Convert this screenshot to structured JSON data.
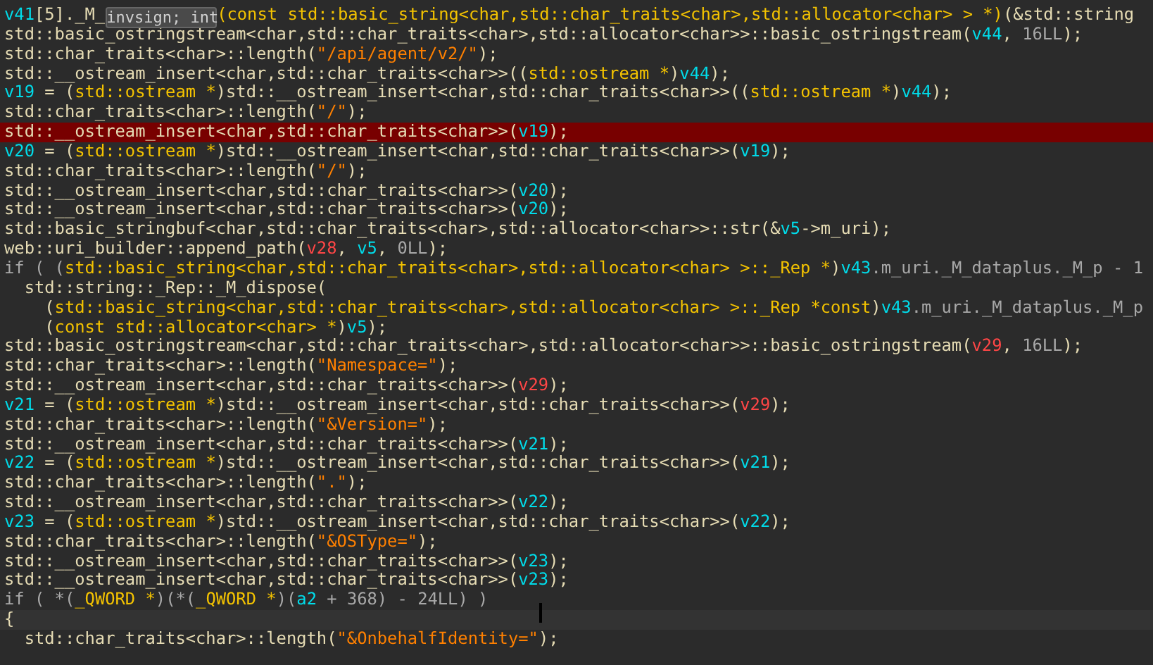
{
  "lines": [
    {
      "kind": "normal",
      "segments": [
        {
          "kind": "var",
          "text": "v41"
        },
        {
          "kind": "plain",
          "text": "[5]._M_"
        },
        {
          "kind": "tooltip",
          "text": "invsign; int"
        },
        {
          "kind": "type",
          "text": "(const std::basic_string<char,std::char_traits<char>,std::allocator<char> > *)"
        },
        {
          "kind": "plain",
          "text": "(&std::string"
        }
      ]
    },
    {
      "kind": "normal",
      "segments": [
        {
          "kind": "plain",
          "text": "std::basic_ostringstream<char,std::char_traits<char>,std::allocator<char>>::basic_ostringstream("
        },
        {
          "kind": "var",
          "text": "v44"
        },
        {
          "kind": "plain",
          "text": ", "
        },
        {
          "kind": "number",
          "text": "16LL"
        },
        {
          "kind": "plain",
          "text": ");"
        }
      ]
    },
    {
      "kind": "normal",
      "segments": [
        {
          "kind": "plain",
          "text": "std::char_traits<char>::length("
        },
        {
          "kind": "string",
          "text": "\"/api/agent/v2/\""
        },
        {
          "kind": "plain",
          "text": ");"
        }
      ]
    },
    {
      "kind": "normal",
      "segments": [
        {
          "kind": "plain",
          "text": "std::__ostream_insert<char,std::char_traits<char>>(("
        },
        {
          "kind": "type",
          "text": "std::ostream *"
        },
        {
          "kind": "plain",
          "text": ")"
        },
        {
          "kind": "var",
          "text": "v44"
        },
        {
          "kind": "plain",
          "text": ");"
        }
      ]
    },
    {
      "kind": "normal",
      "segments": [
        {
          "kind": "var",
          "text": "v19"
        },
        {
          "kind": "plain",
          "text": " = ("
        },
        {
          "kind": "type",
          "text": "std::ostream *"
        },
        {
          "kind": "plain",
          "text": ")std::__ostream_insert<char,std::char_traits<char>>(("
        },
        {
          "kind": "type",
          "text": "std::ostream *"
        },
        {
          "kind": "plain",
          "text": ")"
        },
        {
          "kind": "var",
          "text": "v44"
        },
        {
          "kind": "plain",
          "text": ");"
        }
      ]
    },
    {
      "kind": "normal",
      "segments": [
        {
          "kind": "plain",
          "text": "std::char_traits<char>::length("
        },
        {
          "kind": "string",
          "text": "\"/\""
        },
        {
          "kind": "plain",
          "text": ");"
        }
      ]
    },
    {
      "kind": "breakpoint",
      "segments": [
        {
          "kind": "plain",
          "text": "std::__ostream_insert<char,std::char_traits<char>>("
        },
        {
          "kind": "var",
          "text": "v19"
        },
        {
          "kind": "plain",
          "text": ");"
        }
      ]
    },
    {
      "kind": "normal",
      "segments": [
        {
          "kind": "var",
          "text": "v20"
        },
        {
          "kind": "plain",
          "text": " = ("
        },
        {
          "kind": "type",
          "text": "std::ostream *"
        },
        {
          "kind": "plain",
          "text": ")std::__ostream_insert<char,std::char_traits<char>>("
        },
        {
          "kind": "var",
          "text": "v19"
        },
        {
          "kind": "plain",
          "text": ");"
        }
      ]
    },
    {
      "kind": "normal",
      "segments": [
        {
          "kind": "plain",
          "text": "std::char_traits<char>::length("
        },
        {
          "kind": "string",
          "text": "\"/\""
        },
        {
          "kind": "plain",
          "text": ");"
        }
      ]
    },
    {
      "kind": "normal",
      "segments": [
        {
          "kind": "plain",
          "text": "std::__ostream_insert<char,std::char_traits<char>>("
        },
        {
          "kind": "var",
          "text": "v20"
        },
        {
          "kind": "plain",
          "text": ");"
        }
      ]
    },
    {
      "kind": "normal",
      "segments": [
        {
          "kind": "plain",
          "text": "std::__ostream_insert<char,std::char_traits<char>>("
        },
        {
          "kind": "var",
          "text": "v20"
        },
        {
          "kind": "plain",
          "text": ");"
        }
      ]
    },
    {
      "kind": "normal",
      "segments": [
        {
          "kind": "plain",
          "text": "std::basic_stringbuf<char,std::char_traits<char>,std::allocator<char>>::str(&"
        },
        {
          "kind": "var",
          "text": "v5"
        },
        {
          "kind": "plain",
          "text": "->m_uri);"
        }
      ]
    },
    {
      "kind": "normal",
      "segments": [
        {
          "kind": "plain",
          "text": "web::uri_builder::append_path("
        },
        {
          "kind": "local",
          "text": "v28"
        },
        {
          "kind": "plain",
          "text": ", "
        },
        {
          "kind": "var",
          "text": "v5"
        },
        {
          "kind": "plain",
          "text": ", "
        },
        {
          "kind": "number",
          "text": "0LL"
        },
        {
          "kind": "plain",
          "text": ");"
        }
      ]
    },
    {
      "kind": "normal",
      "segments": [
        {
          "kind": "keyword",
          "text": "if ( ("
        },
        {
          "kind": "type",
          "text": "std::basic_string<char,std::char_traits<char>,std::allocator<char> >::_Rep *"
        },
        {
          "kind": "plain",
          "text": ")"
        },
        {
          "kind": "var",
          "text": "v43"
        },
        {
          "kind": "number",
          "text": ".m_uri._M_dataplus._M_p - 1"
        }
      ]
    },
    {
      "kind": "normal",
      "segments": [
        {
          "kind": "plain",
          "text": "  std::string::_Rep::_M_dispose("
        }
      ]
    },
    {
      "kind": "normal",
      "segments": [
        {
          "kind": "plain",
          "text": "    ("
        },
        {
          "kind": "type",
          "text": "std::basic_string<char,std::char_traits<char>,std::allocator<char> >::_Rep *const"
        },
        {
          "kind": "plain",
          "text": ")"
        },
        {
          "kind": "var",
          "text": "v43"
        },
        {
          "kind": "number",
          "text": ".m_uri._M_dataplus._M_p"
        }
      ]
    },
    {
      "kind": "normal",
      "segments": [
        {
          "kind": "plain",
          "text": "    ("
        },
        {
          "kind": "type",
          "text": "const std::allocator<char> *"
        },
        {
          "kind": "plain",
          "text": ")"
        },
        {
          "kind": "var",
          "text": "v5"
        },
        {
          "kind": "plain",
          "text": ");"
        }
      ]
    },
    {
      "kind": "normal",
      "segments": [
        {
          "kind": "plain",
          "text": "std::basic_ostringstream<char,std::char_traits<char>,std::allocator<char>>::basic_ostringstream("
        },
        {
          "kind": "local",
          "text": "v29"
        },
        {
          "kind": "plain",
          "text": ", "
        },
        {
          "kind": "number",
          "text": "16LL"
        },
        {
          "kind": "plain",
          "text": ");"
        }
      ]
    },
    {
      "kind": "normal",
      "segments": [
        {
          "kind": "plain",
          "text": "std::char_traits<char>::length("
        },
        {
          "kind": "string",
          "text": "\"Namespace=\""
        },
        {
          "kind": "plain",
          "text": ");"
        }
      ]
    },
    {
      "kind": "normal",
      "segments": [
        {
          "kind": "plain",
          "text": "std::__ostream_insert<char,std::char_traits<char>>("
        },
        {
          "kind": "local",
          "text": "v29"
        },
        {
          "kind": "plain",
          "text": ");"
        }
      ]
    },
    {
      "kind": "normal",
      "segments": [
        {
          "kind": "var",
          "text": "v21"
        },
        {
          "kind": "plain",
          "text": " = ("
        },
        {
          "kind": "type",
          "text": "std::ostream *"
        },
        {
          "kind": "plain",
          "text": ")std::__ostream_insert<char,std::char_traits<char>>("
        },
        {
          "kind": "local",
          "text": "v29"
        },
        {
          "kind": "plain",
          "text": ");"
        }
      ]
    },
    {
      "kind": "normal",
      "segments": [
        {
          "kind": "plain",
          "text": "std::char_traits<char>::length("
        },
        {
          "kind": "string",
          "text": "\"&Version=\""
        },
        {
          "kind": "plain",
          "text": ");"
        }
      ]
    },
    {
      "kind": "normal",
      "segments": [
        {
          "kind": "plain",
          "text": "std::__ostream_insert<char,std::char_traits<char>>("
        },
        {
          "kind": "var",
          "text": "v21"
        },
        {
          "kind": "plain",
          "text": ");"
        }
      ]
    },
    {
      "kind": "normal",
      "segments": [
        {
          "kind": "var",
          "text": "v22"
        },
        {
          "kind": "plain",
          "text": " = ("
        },
        {
          "kind": "type",
          "text": "std::ostream *"
        },
        {
          "kind": "plain",
          "text": ")std::__ostream_insert<char,std::char_traits<char>>("
        },
        {
          "kind": "var",
          "text": "v21"
        },
        {
          "kind": "plain",
          "text": ");"
        }
      ]
    },
    {
      "kind": "normal",
      "segments": [
        {
          "kind": "plain",
          "text": "std::char_traits<char>::length("
        },
        {
          "kind": "string",
          "text": "\".\""
        },
        {
          "kind": "plain",
          "text": ");"
        }
      ]
    },
    {
      "kind": "normal",
      "segments": [
        {
          "kind": "plain",
          "text": "std::__ostream_insert<char,std::char_traits<char>>("
        },
        {
          "kind": "var",
          "text": "v22"
        },
        {
          "kind": "plain",
          "text": ");"
        }
      ]
    },
    {
      "kind": "normal",
      "segments": [
        {
          "kind": "var",
          "text": "v23"
        },
        {
          "kind": "plain",
          "text": " = ("
        },
        {
          "kind": "type",
          "text": "std::ostream *"
        },
        {
          "kind": "plain",
          "text": ")std::__ostream_insert<char,std::char_traits<char>>("
        },
        {
          "kind": "var",
          "text": "v22"
        },
        {
          "kind": "plain",
          "text": ");"
        }
      ]
    },
    {
      "kind": "normal",
      "segments": [
        {
          "kind": "plain",
          "text": "std::char_traits<char>::length("
        },
        {
          "kind": "string",
          "text": "\"&OSType=\""
        },
        {
          "kind": "plain",
          "text": ");"
        }
      ]
    },
    {
      "kind": "normal",
      "segments": [
        {
          "kind": "plain",
          "text": "std::__ostream_insert<char,std::char_traits<char>>("
        },
        {
          "kind": "var",
          "text": "v23"
        },
        {
          "kind": "plain",
          "text": ");"
        }
      ]
    },
    {
      "kind": "normal",
      "segments": [
        {
          "kind": "plain",
          "text": "std::__ostream_insert<char,std::char_traits<char>>("
        },
        {
          "kind": "var",
          "text": "v23"
        },
        {
          "kind": "plain",
          "text": ");"
        }
      ]
    },
    {
      "kind": "normal",
      "segments": [
        {
          "kind": "keyword",
          "text": "if ( *("
        },
        {
          "kind": "type",
          "text": "_QWORD *"
        },
        {
          "kind": "keyword",
          "text": ")(*("
        },
        {
          "kind": "type",
          "text": "_QWORD *"
        },
        {
          "kind": "keyword",
          "text": ")("
        },
        {
          "kind": "var",
          "text": "a2"
        },
        {
          "kind": "keyword",
          "text": " + 368) - 24LL) )"
        }
      ]
    },
    {
      "kind": "current",
      "segments": [
        {
          "kind": "plain",
          "text": "{"
        }
      ]
    },
    {
      "kind": "normal",
      "segments": [
        {
          "kind": "plain",
          "text": "  std::char_traits<char>::length("
        },
        {
          "kind": "string",
          "text": "\"&OnbehalfIdentity=\""
        },
        {
          "kind": "plain",
          "text": ");"
        }
      ]
    }
  ]
}
